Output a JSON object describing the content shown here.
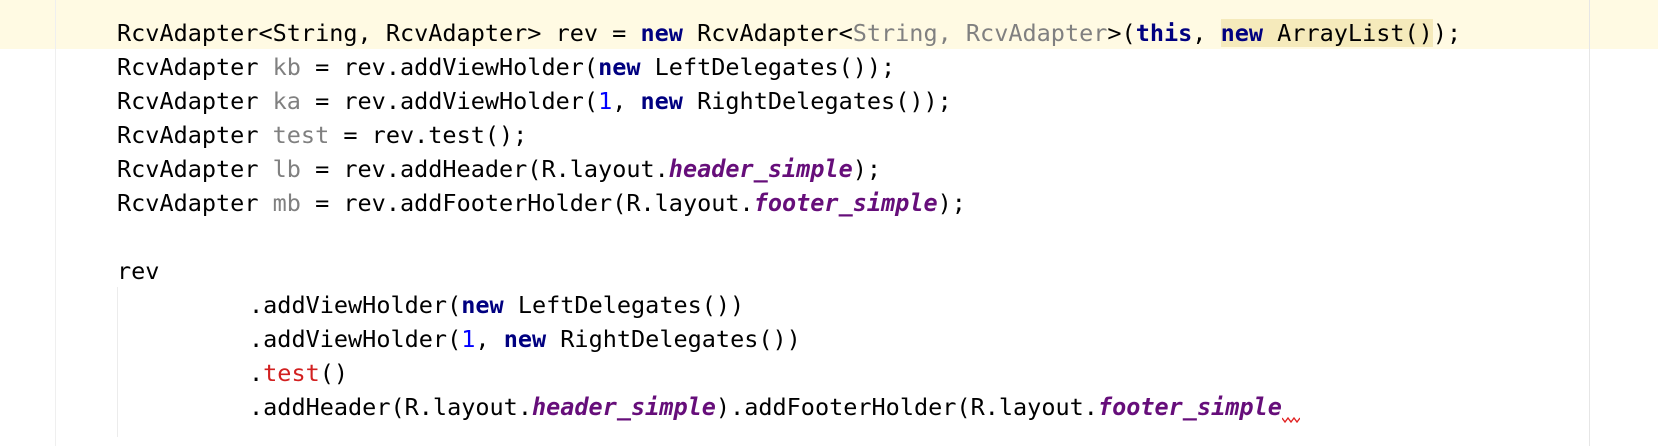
{
  "editor": {
    "lines": [
      [
        {
          "t": "RcvAdapter<String, RcvAdapter> rev = ",
          "c": "plain"
        },
        {
          "t": "new",
          "c": "kw"
        },
        {
          "t": " RcvAdapter<",
          "c": "plain"
        },
        {
          "t": "String, RcvAdapter",
          "c": "var"
        },
        {
          "t": ">(",
          "c": "plain"
        },
        {
          "t": "this",
          "c": "kw"
        },
        {
          "t": ", ",
          "c": "plain"
        },
        {
          "t": "new",
          "c": "kw hl"
        },
        {
          "t": " ArrayList(",
          "c": "hl"
        },
        {
          "t": ")",
          "c": "brace"
        },
        {
          "t": ");",
          "c": "plain"
        }
      ],
      [
        {
          "t": "RcvAdapter ",
          "c": "plain"
        },
        {
          "t": "kb",
          "c": "var"
        },
        {
          "t": " = rev.addViewHolder(",
          "c": "plain"
        },
        {
          "t": "new",
          "c": "kw"
        },
        {
          "t": " LeftDelegates());",
          "c": "plain"
        }
      ],
      [
        {
          "t": "RcvAdapter ",
          "c": "plain"
        },
        {
          "t": "ka",
          "c": "var"
        },
        {
          "t": " = rev.addViewHolder(",
          "c": "plain"
        },
        {
          "t": "1",
          "c": "num"
        },
        {
          "t": ", ",
          "c": "plain"
        },
        {
          "t": "new",
          "c": "kw"
        },
        {
          "t": " RightDelegates());",
          "c": "plain"
        }
      ],
      [
        {
          "t": "RcvAdapter ",
          "c": "plain"
        },
        {
          "t": "test",
          "c": "var"
        },
        {
          "t": " = rev.test();",
          "c": "plain"
        }
      ],
      [
        {
          "t": "RcvAdapter ",
          "c": "plain"
        },
        {
          "t": "lb",
          "c": "var"
        },
        {
          "t": " = rev.addHeader(R.layout.",
          "c": "plain"
        },
        {
          "t": "header_simple",
          "c": "field"
        },
        {
          "t": ");",
          "c": "plain"
        }
      ],
      [
        {
          "t": "RcvAdapter ",
          "c": "plain"
        },
        {
          "t": "mb",
          "c": "var"
        },
        {
          "t": " = rev.addFooterHolder(R.layout.",
          "c": "plain"
        },
        {
          "t": "footer_simple",
          "c": "field"
        },
        {
          "t": ");",
          "c": "plain"
        }
      ],
      [],
      [
        {
          "t": "rev",
          "c": "plain"
        }
      ],
      [
        {
          "t": ".addViewHolder(",
          "c": "plain"
        },
        {
          "t": "new",
          "c": "kw"
        },
        {
          "t": " LeftDelegates())",
          "c": "plain"
        }
      ],
      [
        {
          "t": ".addViewHolder(",
          "c": "plain"
        },
        {
          "t": "1",
          "c": "num"
        },
        {
          "t": ", ",
          "c": "plain"
        },
        {
          "t": "new",
          "c": "kw"
        },
        {
          "t": " RightDelegates())",
          "c": "plain"
        }
      ],
      [
        {
          "t": ".",
          "c": "plain"
        },
        {
          "t": "test",
          "c": "err"
        },
        {
          "t": "()",
          "c": "plain"
        }
      ],
      [
        {
          "t": ".addHeader(R.layout.",
          "c": "plain"
        },
        {
          "t": "header_simple",
          "c": "field"
        },
        {
          "t": ").addFooterHolder(R.layout.",
          "c": "plain"
        },
        {
          "t": "footer_simple",
          "c": "field"
        }
      ]
    ]
  }
}
